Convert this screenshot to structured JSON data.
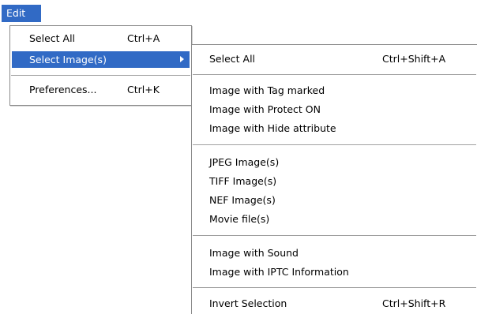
{
  "colors": {
    "highlight": "#316ac5",
    "menu_background": "#ffffff",
    "border": "#8a8a8a",
    "separator": "#a0a0a0"
  },
  "menubar": {
    "edit_label": "Edit"
  },
  "edit_menu": {
    "items": [
      {
        "label": "Select All",
        "shortcut": "Ctrl+A"
      },
      {
        "label": "Select Image(s)",
        "shortcut": "",
        "has_submenu": true,
        "highlighted": true
      },
      {
        "label": "Preferences...",
        "shortcut": "Ctrl+K"
      }
    ]
  },
  "select_images_submenu": {
    "groups": [
      {
        "items": [
          {
            "label": "Select All",
            "shortcut": "Ctrl+Shift+A"
          }
        ]
      },
      {
        "items": [
          {
            "label": "Image with Tag marked"
          },
          {
            "label": "Image with Protect ON"
          },
          {
            "label": "Image with Hide attribute"
          }
        ]
      },
      {
        "items": [
          {
            "label": "JPEG Image(s)"
          },
          {
            "label": "TIFF Image(s)"
          },
          {
            "label": "NEF Image(s)"
          },
          {
            "label": "Movie file(s)"
          }
        ]
      },
      {
        "items": [
          {
            "label": "Image with Sound"
          },
          {
            "label": "Image with IPTC Information"
          }
        ]
      },
      {
        "items": [
          {
            "label": "Invert Selection",
            "shortcut": "Ctrl+Shift+R"
          }
        ]
      }
    ]
  }
}
